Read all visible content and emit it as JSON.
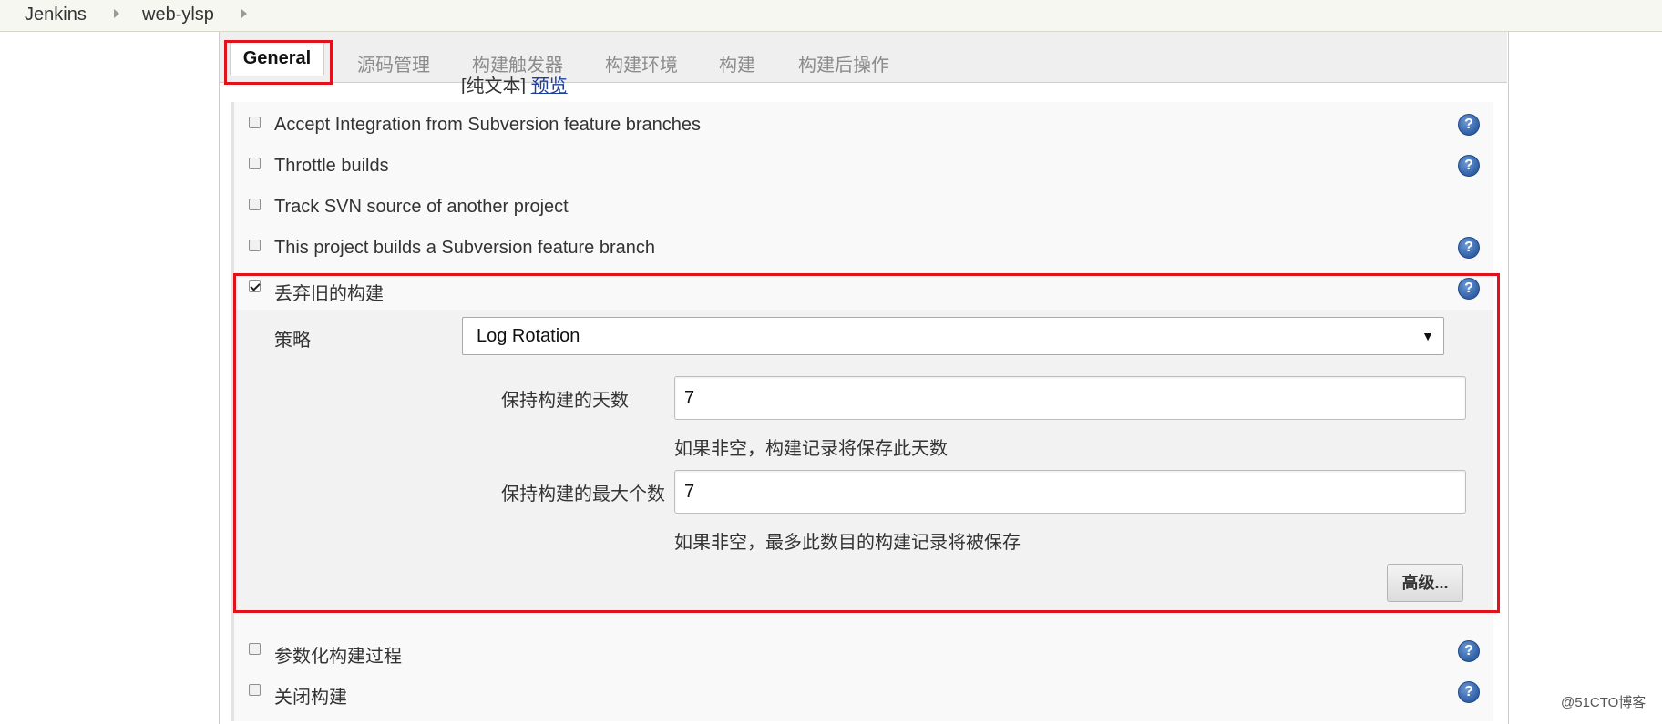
{
  "breadcrumb": {
    "items": [
      "Jenkins",
      "web-ylsp"
    ]
  },
  "tabs": [
    {
      "label": "General",
      "active": true
    },
    {
      "label": "源码管理"
    },
    {
      "label": "构建触发器"
    },
    {
      "label": "构建环境"
    },
    {
      "label": "构建"
    },
    {
      "label": "构建后操作"
    }
  ],
  "description_links": {
    "plain": "[纯文本]",
    "preview": "预览"
  },
  "options": [
    {
      "label": "Accept Integration from Subversion feature branches",
      "checked": false,
      "help": true
    },
    {
      "label": "Throttle builds",
      "checked": false,
      "help": true
    },
    {
      "label": "Track SVN source of another project",
      "checked": false,
      "help": false
    },
    {
      "label": "This project builds a Subversion feature branch",
      "checked": false,
      "help": true
    },
    {
      "label": "丢弃旧的构建",
      "checked": true,
      "help": true
    },
    {
      "label": "参数化构建过程",
      "checked": false,
      "help": true
    },
    {
      "label": "关闭构建",
      "checked": false,
      "help": true
    }
  ],
  "discard": {
    "strategy_label": "策略",
    "strategy_value": "Log Rotation",
    "days_label": "保持构建的天数",
    "days_value": "7",
    "days_hint": "如果非空，构建记录将保存此天数",
    "max_label": "保持构建的最大个数",
    "max_value": "7",
    "max_hint": "如果非空，最多此数目的构建记录将被保存",
    "advanced_button": "高级..."
  },
  "help_icon_glyph": "?",
  "watermark": "@51CTO博客",
  "colors": {
    "highlight": "#e0131c",
    "help_icon": "#2f5fa6",
    "link": "#21409a"
  }
}
